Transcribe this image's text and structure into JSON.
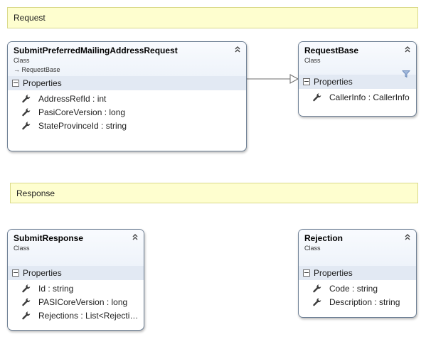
{
  "comments": {
    "request": "Request",
    "response": "Response"
  },
  "classes": {
    "submit_request": {
      "name": "SubmitPreferredMailingAddressRequest",
      "kind": "Class",
      "base": "→ RequestBase",
      "section": "Properties",
      "properties": [
        "AddressRefId : int",
        "PasiCoreVersion : long",
        "StateProvinceId : string"
      ]
    },
    "request_base": {
      "name": "RequestBase",
      "kind": "Class",
      "section": "Properties",
      "properties": [
        "CallerInfo : CallerInfo"
      ]
    },
    "submit_response": {
      "name": "SubmitResponse",
      "kind": "Class",
      "section": "Properties",
      "properties": [
        "Id : string",
        "PASICoreVersion : long",
        "Rejections :  List<Rejecti…"
      ]
    },
    "rejection": {
      "name": "Rejection",
      "kind": "Class",
      "section": "Properties",
      "properties": [
        "Code : string",
        "Description : string"
      ]
    }
  },
  "icons": {
    "collapse": "chevron-up-double-icon",
    "property": "wrench-icon",
    "filter": "filter-icon"
  },
  "colors": {
    "comment_bg": "#fefecf",
    "shape_border": "#6d7f94",
    "section_bg": "#e2e9f3"
  }
}
